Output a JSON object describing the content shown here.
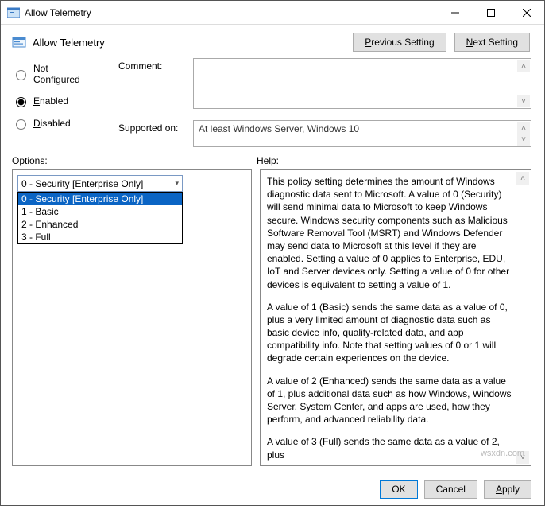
{
  "window": {
    "title": "Allow Telemetry"
  },
  "header": {
    "policy_title": "Allow Telemetry",
    "prev": "Previous Setting",
    "prev_u": "P",
    "next": "Next Setting",
    "next_u": "N"
  },
  "radios": {
    "not_configured": "Not Configured",
    "enabled": "Enabled",
    "disabled": "Disabled",
    "selected": "enabled",
    "nc_u": "C",
    "en_u": "E",
    "dis_u": "D"
  },
  "labels": {
    "comment": "Comment:",
    "supported": "Supported on:",
    "options": "Options:",
    "help": "Help:"
  },
  "comment": {
    "value": ""
  },
  "supported": {
    "value": "At least Windows Server, Windows 10"
  },
  "options": {
    "selected": "0 - Security [Enterprise Only]",
    "items": [
      "0 - Security [Enterprise Only]",
      "1 - Basic",
      "2 - Enhanced",
      "3 - Full"
    ]
  },
  "help": {
    "p1": "This policy setting determines the amount of Windows diagnostic data sent to Microsoft. A value of 0 (Security) will send minimal data to Microsoft to keep Windows secure. Windows security components such as Malicious Software Removal Tool (MSRT) and Windows Defender may send data to Microsoft at this level if they are enabled. Setting a value of 0 applies to Enterprise, EDU, IoT and Server devices only. Setting a value of 0 for other devices is equivalent to setting a value of 1.",
    "p2": "A value of 1 (Basic) sends the same data as a value of 0, plus a very limited amount of diagnostic data such as basic device info, quality-related data, and app compatibility info. Note that setting values of 0 or 1 will degrade certain experiences on the device.",
    "p3": "A value of 2 (Enhanced) sends the same data as a value of 1, plus additional data such as how Windows, Windows Server, System Center, and apps are used, how they perform, and advanced reliability data.",
    "p4": "A value of 3 (Full) sends the same data as a value of 2, plus"
  },
  "footer": {
    "ok": "OK",
    "cancel": "Cancel",
    "apply": "Apply",
    "apply_u": "A"
  },
  "watermark": "wsxdn.com"
}
